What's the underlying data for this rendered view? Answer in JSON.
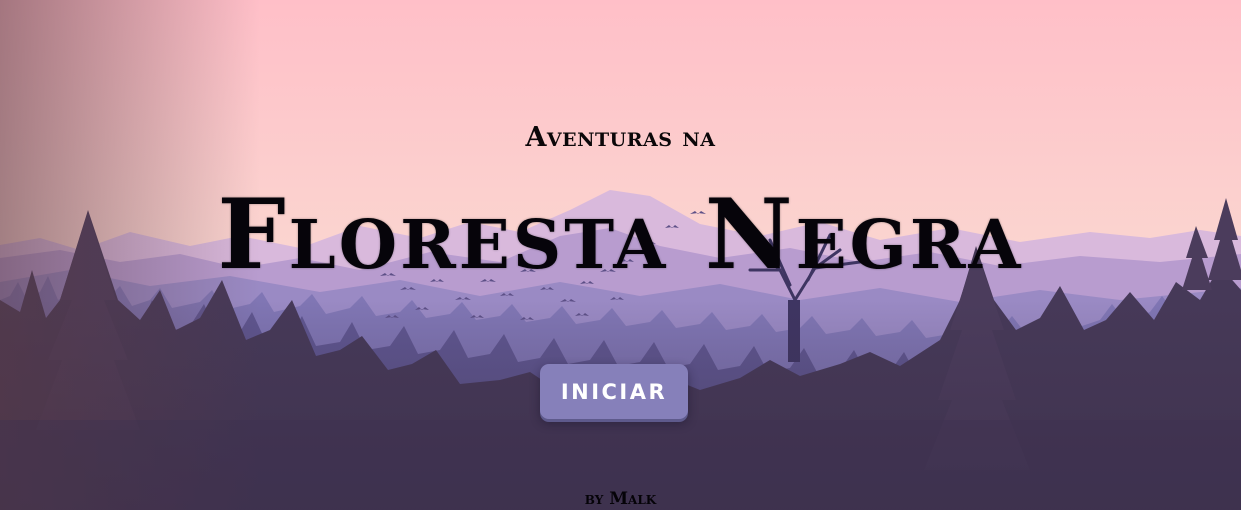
{
  "header": {
    "subtitle": "Aventuras na",
    "title": "Floresta Negra"
  },
  "menu": {
    "start_label": "INICIAR"
  },
  "footer": {
    "credit": "by Malk"
  },
  "colors": {
    "sky_top": "#ffc1c9",
    "sky_bottom": "#f6d6d0",
    "mountain": "#c9a8d8",
    "forest_far": "#8078b5",
    "forest_near": "#3e3048",
    "button": "#8680ba"
  },
  "icons": [
    "bird-flock-icon",
    "bare-tree-icon",
    "pine-tree-icon"
  ]
}
